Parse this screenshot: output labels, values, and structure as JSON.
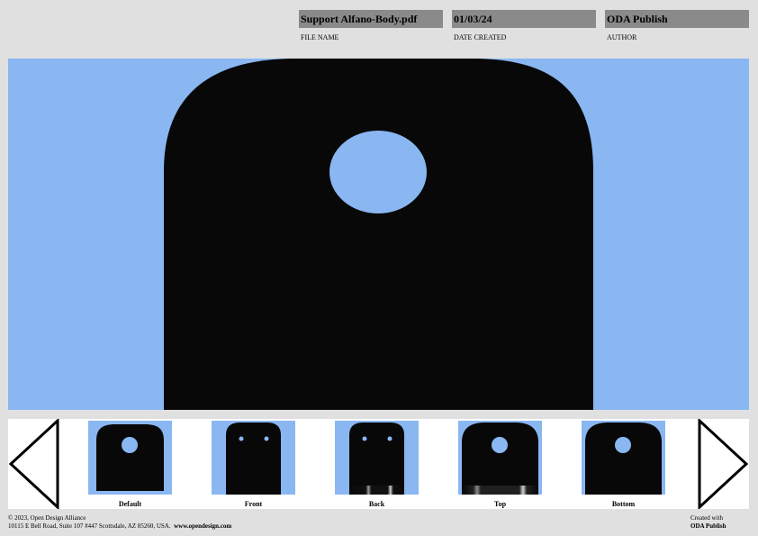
{
  "header": {
    "file_name": "Support Alfano-Body.pdf",
    "file_name_label": "FILE NAME",
    "date_created": "01/03/24",
    "date_created_label": "DATE CREATED",
    "author": "ODA Publish",
    "author_label": "AUTHOR"
  },
  "colors": {
    "background": "#e0e0e0",
    "meta_box": "#8a8a8a",
    "viewport": "#8ab7f2",
    "model": "#080808"
  },
  "viewport": {
    "model_icon": "support-body-3d-model"
  },
  "thumbnails": {
    "prev_icon": "arrow-left-icon",
    "next_icon": "arrow-right-icon",
    "items": [
      {
        "label": "Default"
      },
      {
        "label": "Front"
      },
      {
        "label": "Back"
      },
      {
        "label": "Top"
      },
      {
        "label": "Bottom"
      }
    ]
  },
  "footer": {
    "copyright": "©  2023, Open Design Alliance",
    "address": "10115 E Bell Road, Suite 107 #447 Scottsdale, AZ 85260, USA.",
    "website": "www.opendesign.com",
    "created_with_label": "Created with",
    "created_with_app": "ODA Publish"
  }
}
